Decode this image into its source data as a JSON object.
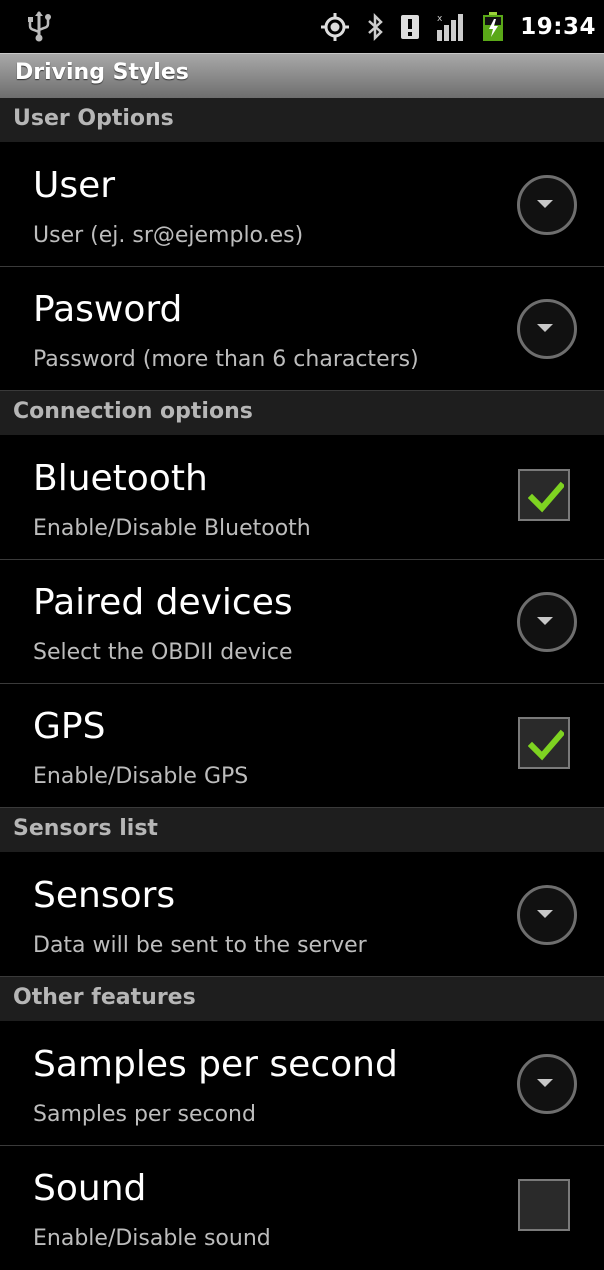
{
  "status_bar": {
    "time": "19:34",
    "icons": [
      "usb-icon",
      "gps-icon",
      "bluetooth-icon",
      "alert-icon",
      "signal-icon",
      "battery-charging-icon"
    ]
  },
  "title": "Driving Styles",
  "colors": {
    "background": "#000000",
    "category_bg": "#1e1e1e",
    "category_text": "#b6b6b6",
    "summary_text": "#bdbdbd",
    "check_green": "#7ed321"
  },
  "sections": [
    {
      "header": "User Options",
      "items": [
        {
          "title": "User",
          "summary": "User (ej. sr@ejemplo.es)",
          "widget": "dropdown"
        },
        {
          "title": "Pasword",
          "summary": "Password (more than 6 characters)",
          "widget": "dropdown"
        }
      ]
    },
    {
      "header": "Connection options",
      "items": [
        {
          "title": "Bluetooth",
          "summary": "Enable/Disable Bluetooth",
          "widget": "checkbox",
          "checked": true
        },
        {
          "title": "Paired devices",
          "summary": "Select the OBDII device",
          "widget": "dropdown"
        },
        {
          "title": "GPS",
          "summary": "Enable/Disable GPS",
          "widget": "checkbox",
          "checked": true
        }
      ]
    },
    {
      "header": "Sensors list",
      "items": [
        {
          "title": "Sensors",
          "summary": "Data will be sent to the server",
          "widget": "dropdown"
        }
      ]
    },
    {
      "header": "Other features",
      "items": [
        {
          "title": "Samples per second",
          "summary": "Samples per second",
          "widget": "dropdown"
        },
        {
          "title": "Sound",
          "summary": "Enable/Disable sound",
          "widget": "checkbox",
          "checked": false
        }
      ]
    }
  ]
}
